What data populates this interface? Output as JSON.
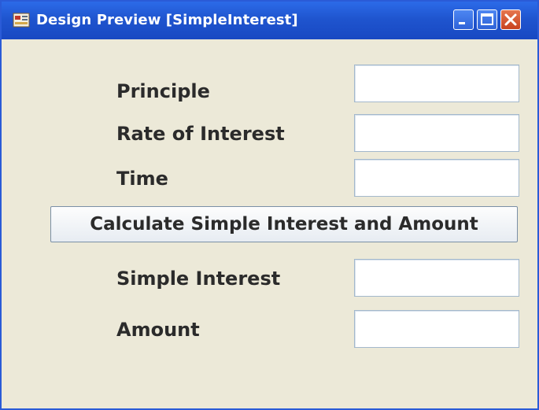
{
  "window": {
    "title": "Design Preview [SimpleInterest]",
    "icon": "app-design-icon",
    "controls": [
      "minimize-icon",
      "maximize-icon",
      "close-icon"
    ],
    "colors": {
      "titlebar": "#1f55cf",
      "close_button": "#c8421f",
      "background": "#ece9d8"
    }
  },
  "form": {
    "principle_label": "Principle",
    "principle_value": "",
    "rate_label": "Rate of Interest",
    "rate_value": "",
    "time_label": "Time",
    "time_value": "",
    "calculate_button_label": "Calculate Simple Interest and Amount",
    "simple_interest_label": "Simple Interest",
    "simple_interest_value": "",
    "amount_label": "Amount",
    "amount_value": ""
  }
}
